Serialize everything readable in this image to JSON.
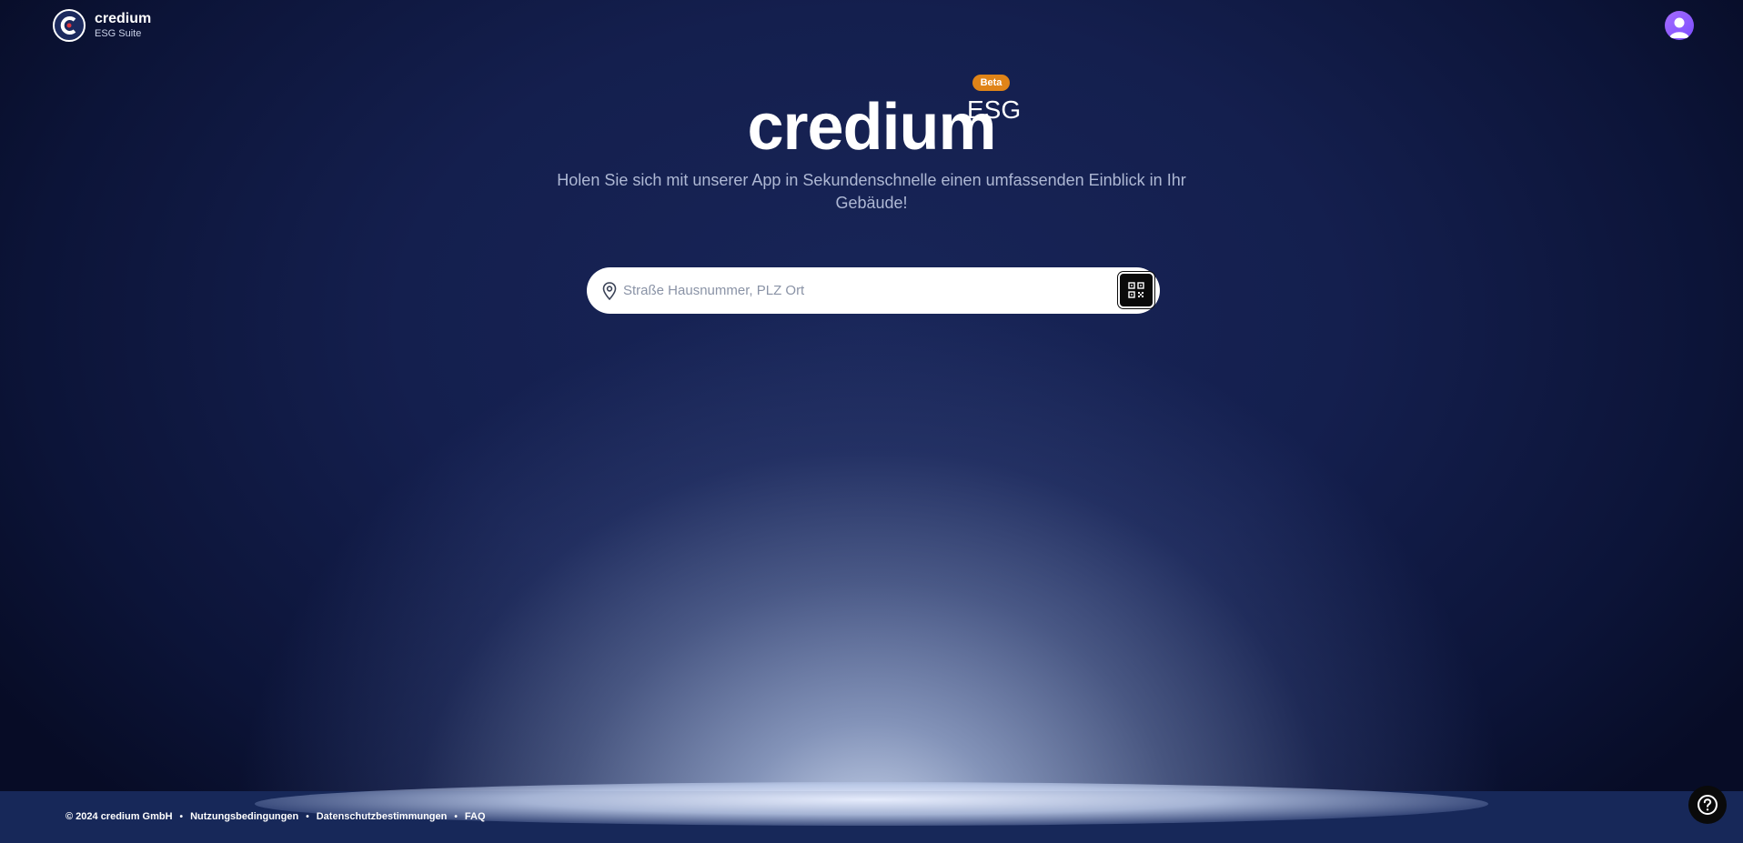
{
  "brand": {
    "name": "credium",
    "subtitle": "ESG Suite",
    "logo_icon": "credium-logo-icon"
  },
  "user": {
    "avatar_icon": "user-avatar-icon",
    "avatar_color": "#8a5cff"
  },
  "hero": {
    "wordmark": "credium",
    "superscript": "ESG",
    "badge": "Beta",
    "badge_color": "#e08418",
    "tagline": "Holen Sie sich mit unserer App in Sekundenschnelle einen umfassenden Einblick in Ihr Gebäude!"
  },
  "search": {
    "placeholder": "Straße Hausnummer, PLZ Ort",
    "value": "",
    "location_icon": "map-pin-icon",
    "qr_icon": "qr-code-scan-icon"
  },
  "footer": {
    "copyright": "© 2024 credium GmbH",
    "links": [
      "Nutzungsbedingungen",
      "Datenschutzbestimmungen",
      "FAQ"
    ],
    "separator": "•",
    "help_icon": "help-icon"
  },
  "colors": {
    "background": "#141f4e",
    "footer": "#172859",
    "accent": "#e08418"
  }
}
